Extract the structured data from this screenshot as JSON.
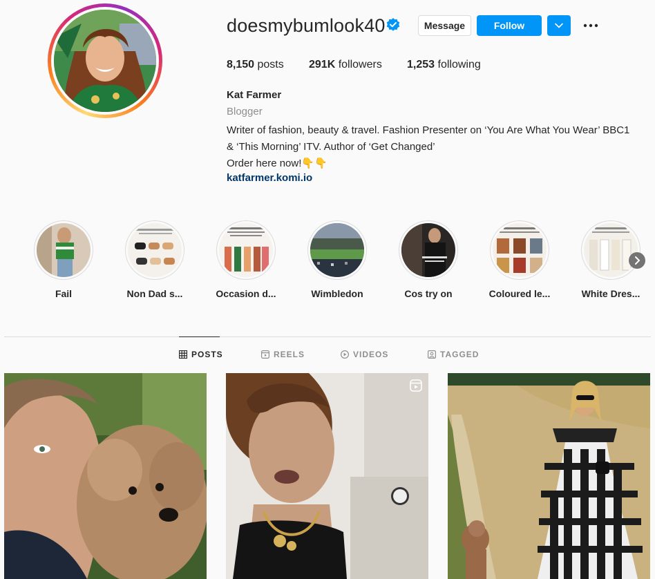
{
  "profile": {
    "username": "doesmybumlook40",
    "verified": true,
    "buttons": {
      "message": "Message",
      "follow": "Follow"
    },
    "stats": {
      "posts_count": "8,150",
      "posts_label": "posts",
      "followers_count": "291K",
      "followers_label": "followers",
      "following_count": "1,253",
      "following_label": "following"
    },
    "bio": {
      "name": "Kat Farmer",
      "category": "Blogger",
      "line1": "Writer of fashion, beauty & travel. Fashion Presenter on ‘You Are What You Wear’ BBC1",
      "line2": "& ‘This Morning’ ITV. Author of ‘Get Changed’",
      "line3": "Order here now!👇👇",
      "link": "katfarmer.komi.io"
    }
  },
  "highlights": [
    {
      "label": "Fail"
    },
    {
      "label": "Non Dad s..."
    },
    {
      "label": "Occasion d..."
    },
    {
      "label": "Wimbledon"
    },
    {
      "label": "Cos try on"
    },
    {
      "label": "Coloured le..."
    },
    {
      "label": "White Dres..."
    }
  ],
  "tabs": [
    {
      "label": "POSTS",
      "icon": "grid-icon",
      "active": true
    },
    {
      "label": "REELS",
      "icon": "reels-icon",
      "active": false
    },
    {
      "label": "VIDEOS",
      "icon": "play-icon",
      "active": false
    },
    {
      "label": "TAGGED",
      "icon": "tagged-icon",
      "active": false
    }
  ],
  "colors": {
    "accent": "#0095f6",
    "link": "#00376b",
    "muted": "#8e8e8e",
    "border": "#dbdbdb"
  }
}
